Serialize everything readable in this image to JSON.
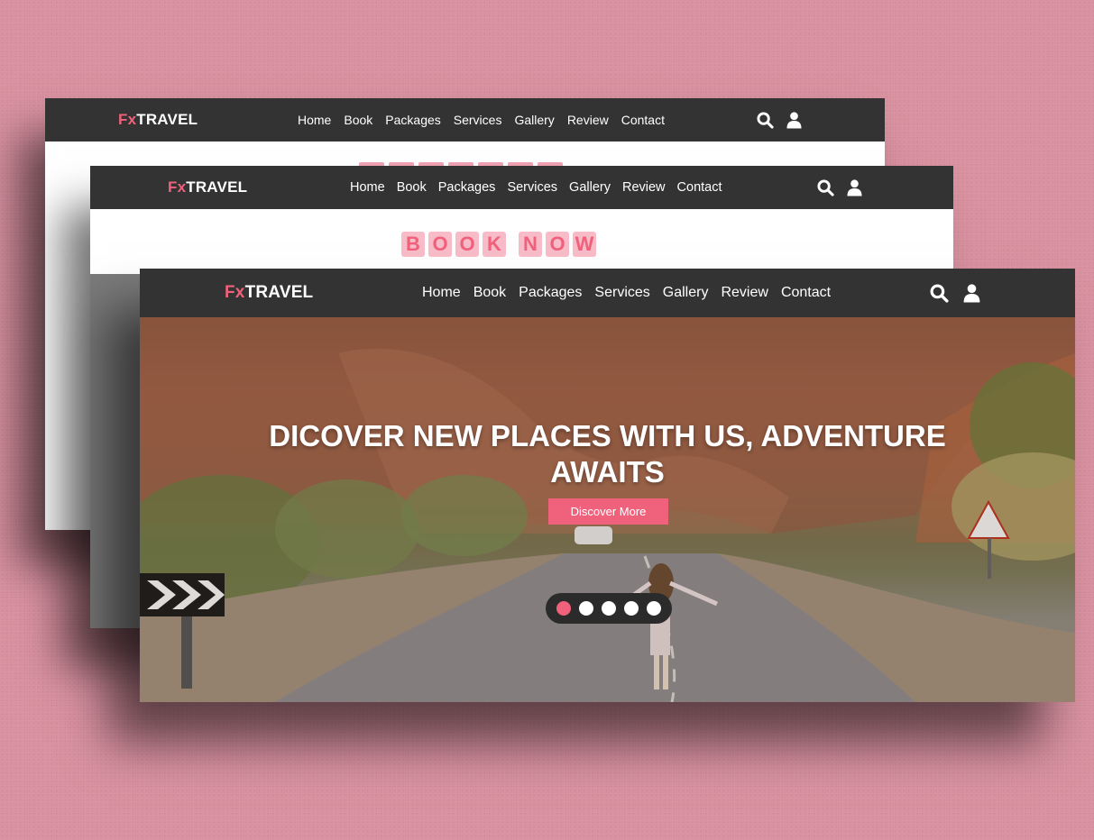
{
  "brand": {
    "prefix": "Fx",
    "name": "TRAVEL"
  },
  "nav": {
    "links": [
      "Home",
      "Book",
      "Packages",
      "Services",
      "Gallery",
      "Review",
      "Contact"
    ]
  },
  "icons": {
    "search": "search-icon",
    "user": "user-icon"
  },
  "book_section": {
    "word1": [
      "B",
      "O",
      "O",
      "K"
    ],
    "word2": [
      "N",
      "O",
      "W"
    ]
  },
  "hero": {
    "title": "DICOVER NEW PLACES WITH US, ADVENTURE AWAITS",
    "button_label": "Discover More",
    "slides": {
      "count": 5,
      "active": 1
    }
  },
  "colors": {
    "accent": "#f0617c",
    "nav_bg": "#333333",
    "background": "#d9909f"
  }
}
